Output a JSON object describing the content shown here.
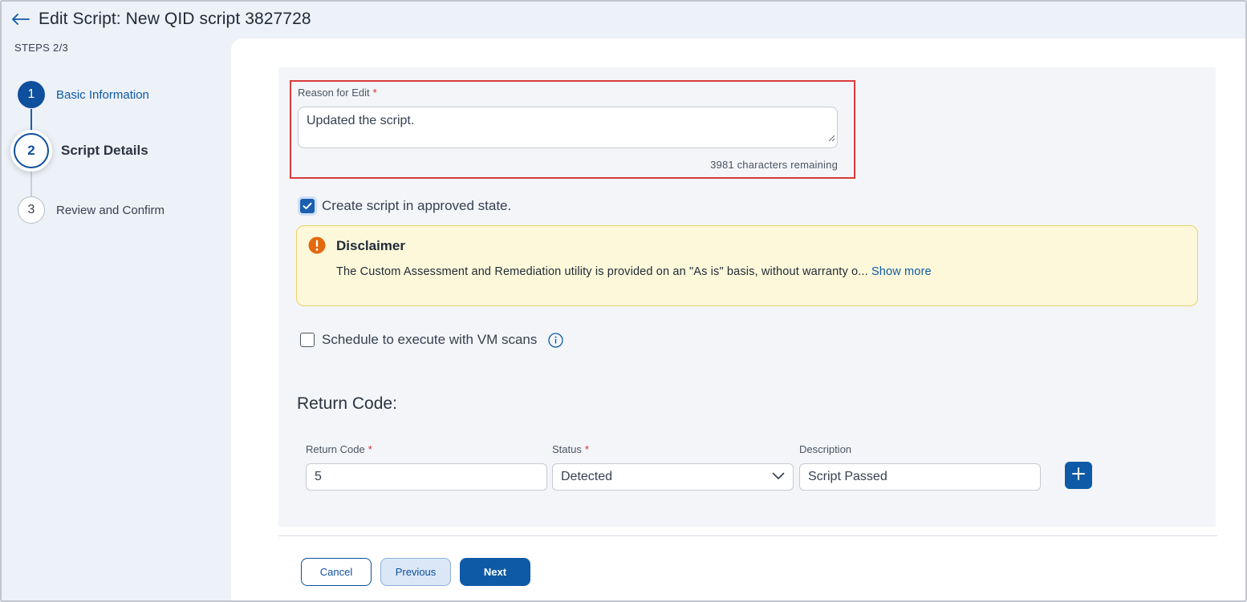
{
  "header": {
    "title": "Edit Script: New QID script 3827728"
  },
  "sidebar": {
    "steps_label": "STEPS 2/3",
    "steps": [
      {
        "number": "1",
        "label": "Basic Information",
        "state": "completed"
      },
      {
        "number": "2",
        "label": "Script Details",
        "state": "active"
      },
      {
        "number": "3",
        "label": "Review and Confirm",
        "state": "pending"
      }
    ]
  },
  "form": {
    "reason": {
      "label": "Reason for Edit",
      "required_mark": "*",
      "value": "Updated the script.",
      "chars_remaining": "3981 characters remaining"
    },
    "approved_checkbox": {
      "label": "Create script in approved state.",
      "checked": true
    },
    "disclaimer": {
      "title": "Disclaimer",
      "text": "The Custom Assessment and Remediation utility is provided on an \"As is\" basis, without warranty o...",
      "show_more": "Show more"
    },
    "schedule_checkbox": {
      "label": "Schedule to execute with VM scans",
      "checked": false
    },
    "return_code_section": {
      "title": "Return Code:",
      "columns": {
        "return_code": "Return Code",
        "status": "Status",
        "description": "Description"
      },
      "required_mark": "*",
      "row": {
        "return_code": "5",
        "status": "Detected",
        "description": "Script Passed"
      }
    }
  },
  "footer": {
    "cancel_label": "Cancel",
    "previous_label": "Previous",
    "next_label": "Next"
  },
  "colors": {
    "primary": "#0e5aa7",
    "error_outline": "#d93b3b",
    "warning_bg": "#fdf8da",
    "warning_icon": "#e3690f"
  }
}
